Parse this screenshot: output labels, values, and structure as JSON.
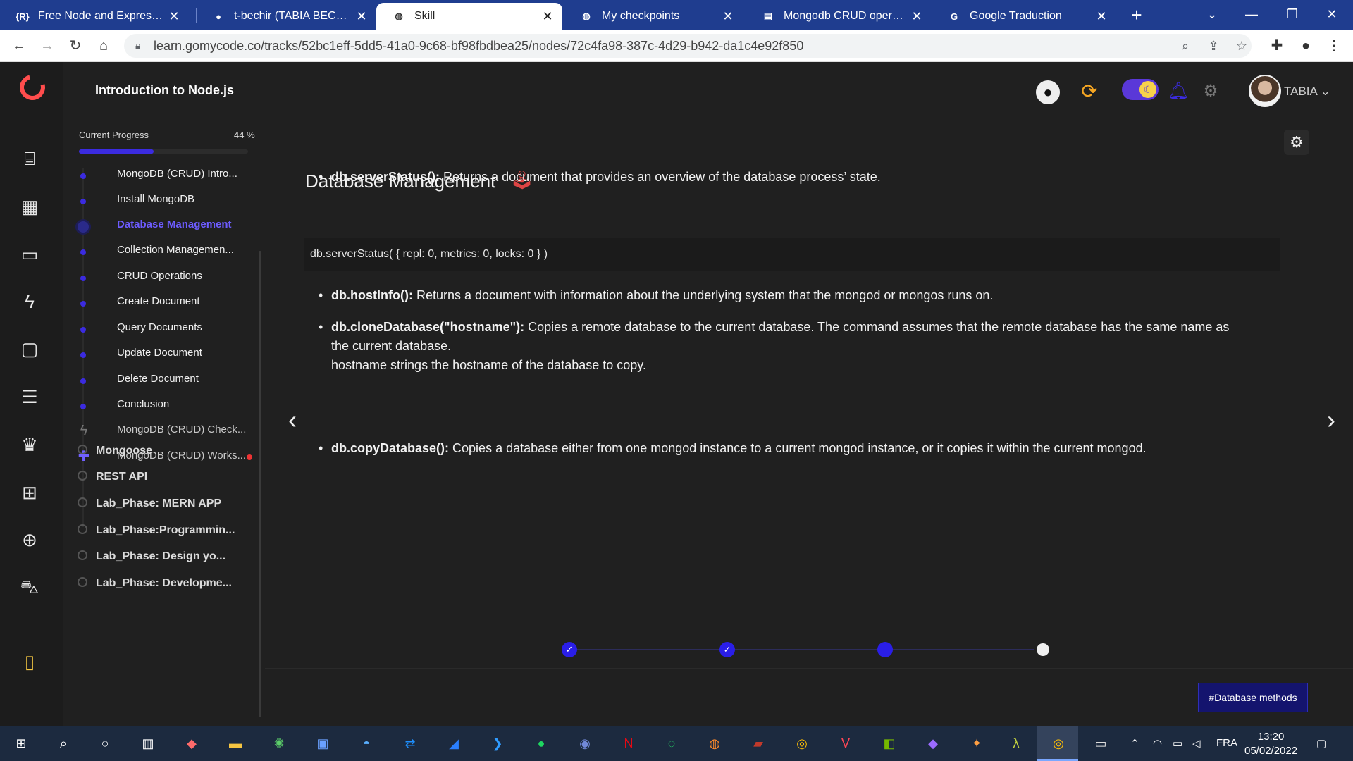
{
  "browser": {
    "tabs": [
      {
        "label": "Free Node and Express Fun",
        "favicon": "R",
        "active": false
      },
      {
        "label": "t-bechir (TABIA BECHIR)",
        "favicon": "github-icon",
        "active": false
      },
      {
        "label": "Skill",
        "favicon": "globe-icon",
        "active": true
      },
      {
        "label": "My checkpoints",
        "favicon": "globe-icon",
        "active": false
      },
      {
        "label": "Mongodb CRUD operation",
        "favicon": "doc-icon",
        "active": false
      },
      {
        "label": "Google Traduction",
        "favicon": "translate-icon",
        "active": false
      }
    ],
    "url": "learn.gomycode.co/tracks/52bc1eff-5dd5-41a0-9c68-bf98fbdbea25/nodes/72c4fa98-387c-4d29-b942-da1c4e92f850"
  },
  "sidebar": {
    "course_title": "Introduction to Node.js",
    "progress_label": "Current Progress",
    "progress_value": "44 %",
    "progress_fraction": 0.44,
    "lessons": [
      {
        "label": "MongoDB (CRUD) Intro...",
        "state": "normal"
      },
      {
        "label": "Install MongoDB",
        "state": "normal"
      },
      {
        "label": "Database Management",
        "state": "active"
      },
      {
        "label": "Collection Managemen...",
        "state": "normal"
      },
      {
        "label": "CRUD Operations",
        "state": "normal"
      },
      {
        "label": "Create Document",
        "state": "normal"
      },
      {
        "label": "Query Documents",
        "state": "normal"
      },
      {
        "label": "Update Document",
        "state": "normal"
      },
      {
        "label": "Delete Document",
        "state": "normal"
      },
      {
        "label": "Conclusion",
        "state": "normal"
      },
      {
        "label": "MongoDB (CRUD) Check...",
        "state": "checkpoint"
      },
      {
        "label": "MongoDB (CRUD) Works...",
        "state": "workshop"
      }
    ],
    "sections": [
      {
        "label": "Mongoose"
      },
      {
        "label": "REST API"
      },
      {
        "label": "Lab_Phase: MERN APP"
      },
      {
        "label": "Lab_Phase:Programmin..."
      },
      {
        "label": "Lab_Phase: Design yo..."
      },
      {
        "label": "Lab_Phase: Developme..."
      }
    ]
  },
  "header": {
    "username": "TABIA",
    "accent": "#5a38d8"
  },
  "content": {
    "title": "Database Management",
    "bullet1": {
      "term": "db.serverStatus():",
      "text": " Returns a document that provides an overview of the database process’ state."
    },
    "code": "db.serverStatus( { repl: 0,  metrics: 0, locks: 0 } )",
    "bullet2": {
      "term": "db.hostInfo():",
      "text": " Returns a document with information about the underlying system that the mongod or mongos runs on."
    },
    "bullet3": {
      "term": "db.cloneDatabase(\"hostname\"):",
      "text": " Copies a remote database to the current database. The command assumes that the remote database has the same name as the current database.",
      "line2": "hostname strings the hostname of the database to copy."
    },
    "bullet4": {
      "term": "db.copyDatabase():",
      "text": " Copies a database either from one mongod instance to a current mongod instance, or it copies it within the current mongod."
    },
    "tag_button": "#Database methods"
  },
  "taskbar": {
    "language": "FRA",
    "time": "13:20",
    "date": "05/02/2022"
  }
}
